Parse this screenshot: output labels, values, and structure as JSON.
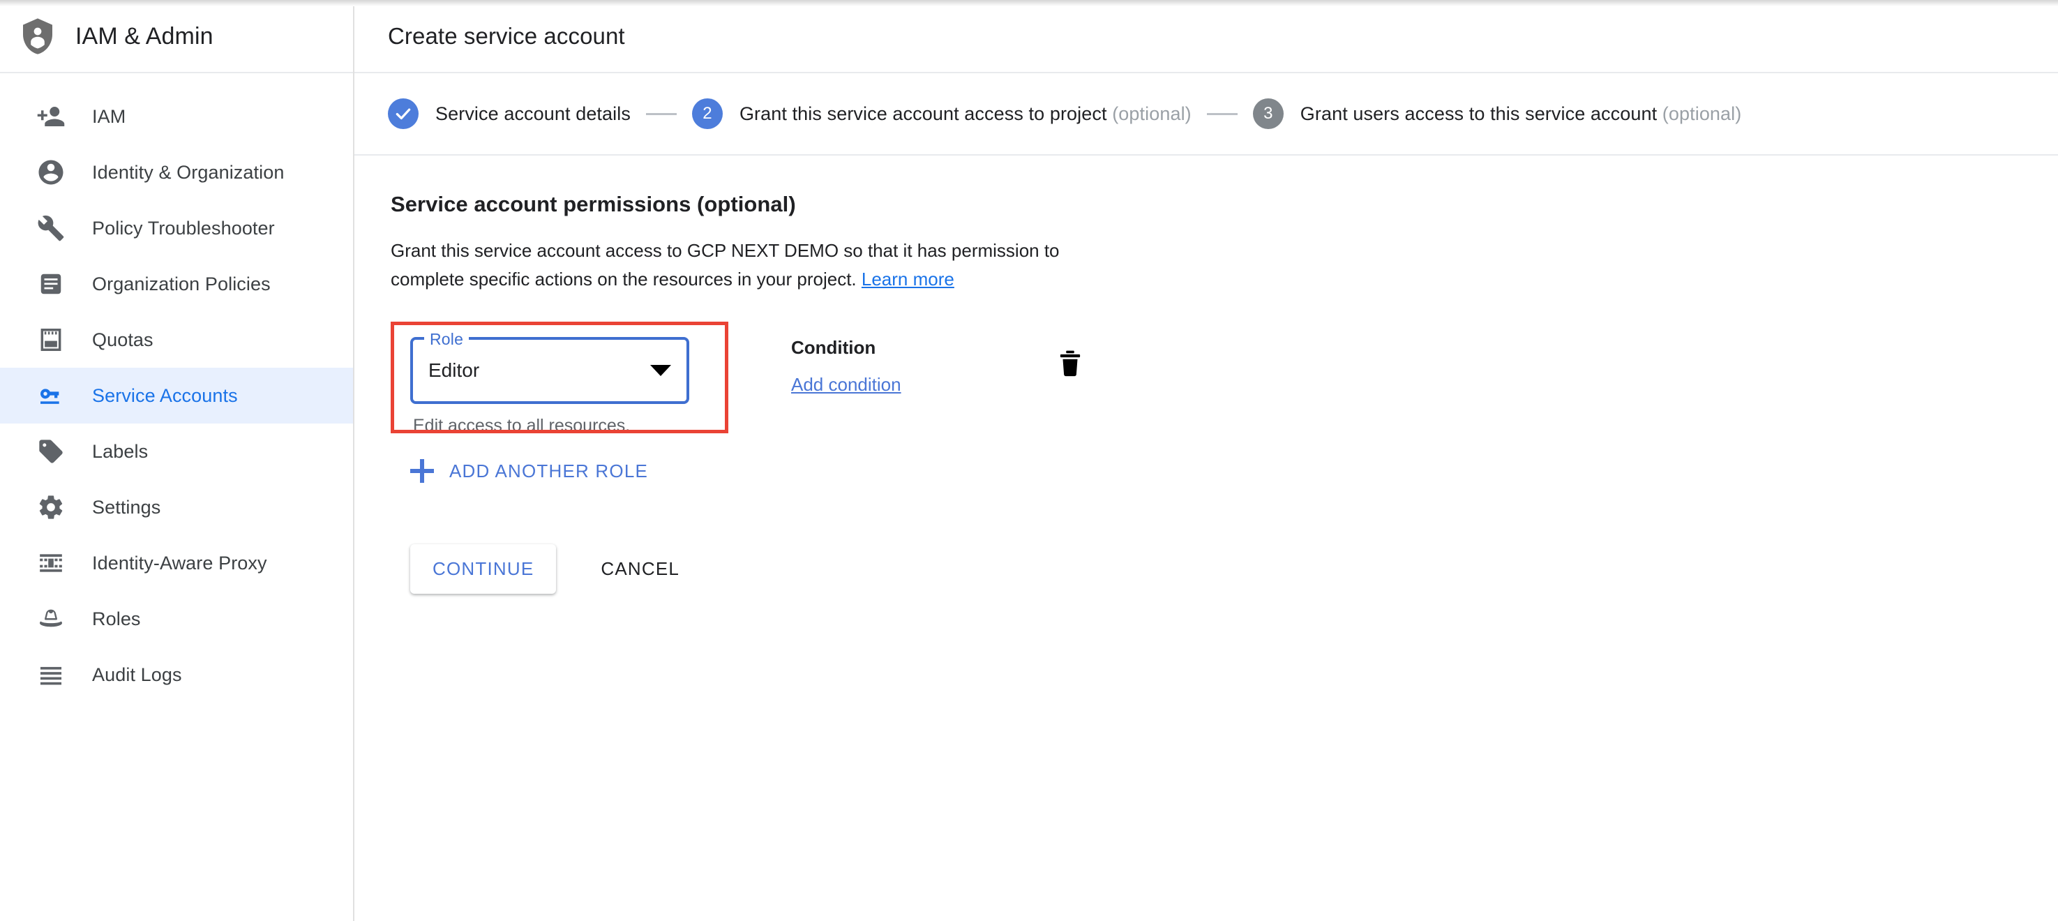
{
  "sidebar": {
    "header": {
      "title": "IAM & Admin",
      "logo_icon": "shield-person-icon"
    },
    "items": [
      {
        "label": "IAM",
        "icon": "person-add-icon",
        "selected": false
      },
      {
        "label": "Identity & Organization",
        "icon": "account-circle-icon",
        "selected": false
      },
      {
        "label": "Policy Troubleshooter",
        "icon": "wrench-icon",
        "selected": false
      },
      {
        "label": "Organization Policies",
        "icon": "list-document-icon",
        "selected": false
      },
      {
        "label": "Quotas",
        "icon": "quota-icon",
        "selected": false
      },
      {
        "label": "Service Accounts",
        "icon": "key-icon",
        "selected": true
      },
      {
        "label": "Labels",
        "icon": "label-tag-icon",
        "selected": false
      },
      {
        "label": "Settings",
        "icon": "gear-icon",
        "selected": false
      },
      {
        "label": "Identity-Aware Proxy",
        "icon": "proxy-icon",
        "selected": false
      },
      {
        "label": "Roles",
        "icon": "fedora-hat-icon",
        "selected": false
      },
      {
        "label": "Audit Logs",
        "icon": "lines-icon",
        "selected": false
      }
    ]
  },
  "header": {
    "title": "Create service account"
  },
  "stepper": {
    "steps": [
      {
        "number": "1",
        "state": "done",
        "label": "Service account details",
        "optional": ""
      },
      {
        "number": "2",
        "state": "active",
        "label": "Grant this service account access to project",
        "optional": "(optional)"
      },
      {
        "number": "3",
        "state": "inactive",
        "label": "Grant users access to this service account",
        "optional": "(optional)"
      }
    ]
  },
  "main": {
    "section_title": "Service account permissions (optional)",
    "description_part1": "Grant this service account access to GCP NEXT DEMO so that it has permission to complete specific actions on the resources in your project. ",
    "learn_more_label": "Learn more",
    "project_name": "GCP NEXT DEMO",
    "role_field": {
      "label": "Role",
      "value": "Editor",
      "helper_text": "Edit access to all resources.",
      "dropdown_icon": "chevron-down-icon"
    },
    "condition": {
      "label": "Condition",
      "add_link_label": "Add condition"
    },
    "delete_icon": "trash-icon",
    "add_another_role_label": "ADD ANOTHER ROLE",
    "buttons": {
      "continue_label": "CONTINUE",
      "cancel_label": "CANCEL"
    }
  },
  "colors": {
    "accent_blue": "#1a73e8",
    "link_blue": "#4a76d6",
    "step_blue": "#4d7ddb",
    "step_gray": "#80868b",
    "selected_bg": "#e8f0fe",
    "annotation_red": "#ea4335",
    "field_border": "#3f6fd0",
    "muted_text": "#5f6368",
    "optional_gray": "#9aa0a6"
  }
}
